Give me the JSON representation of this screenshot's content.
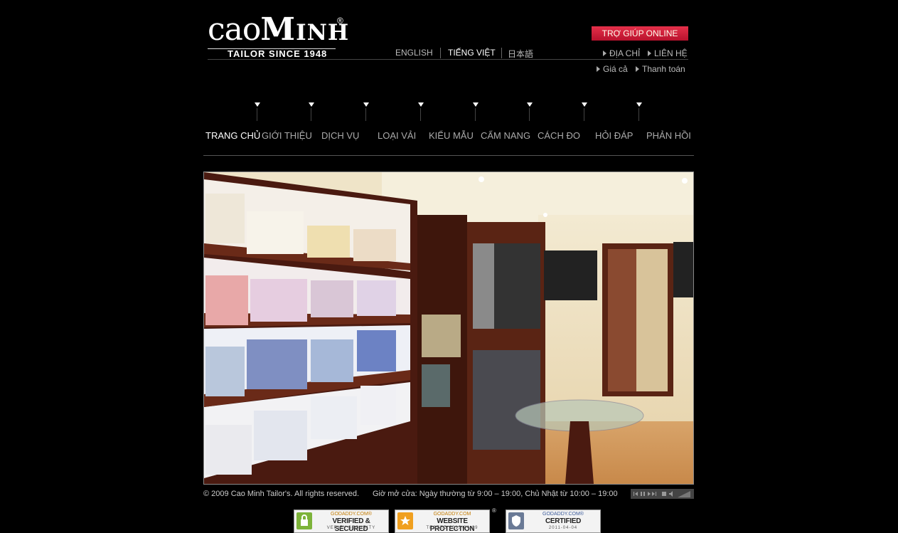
{
  "logo": {
    "word_cao": "cao",
    "word_minh": "Minh",
    "registered": "®",
    "tagline": "TAILOR SINCE 1948"
  },
  "header": {
    "help_button": "TRỢ GIÚP ONLINE",
    "languages": [
      "ENGLISH",
      "TIẾNG VIỆT",
      "日本語"
    ],
    "active_language": "TIẾNG VIỆT",
    "links_row1": [
      "ĐỊA CHỈ",
      "LIÊN HỆ"
    ],
    "links_row2": [
      "Giá cả",
      "Thanh toán"
    ]
  },
  "nav": {
    "items": [
      "TRANG CHỦ",
      "GIỚI THIỆU",
      "DỊCH VỤ",
      "LOẠI VẢI",
      "KIỂU MẪU",
      "CẨM NANG",
      "CÁCH ĐO",
      "HỎI ĐÁP",
      "PHẢN HỒI"
    ],
    "active": "TRANG CHỦ"
  },
  "footer": {
    "copyright": "© 2009 Cao Minh Tailor's. All rights reserved.",
    "hours": "Giờ mở cửa: Ngày thường từ 9:00 – 19:00, Chủ Nhật từ 10:00 – 19:00",
    "badges": [
      {
        "top": "GODADDY.COM®",
        "main": "VERIFIED & SECURED",
        "sub": "VERIFY SECURITY"
      },
      {
        "top": "GODADDY.COM",
        "main": "WEBSITE PROTECTION",
        "sub": "TESTED 2012-04-09"
      },
      {
        "top": "GODADDY.COM®",
        "main": "CERTIFIED",
        "sub": "2011-04-04"
      }
    ]
  },
  "colors": {
    "background": "#000000",
    "accent": "#d11f3a"
  }
}
